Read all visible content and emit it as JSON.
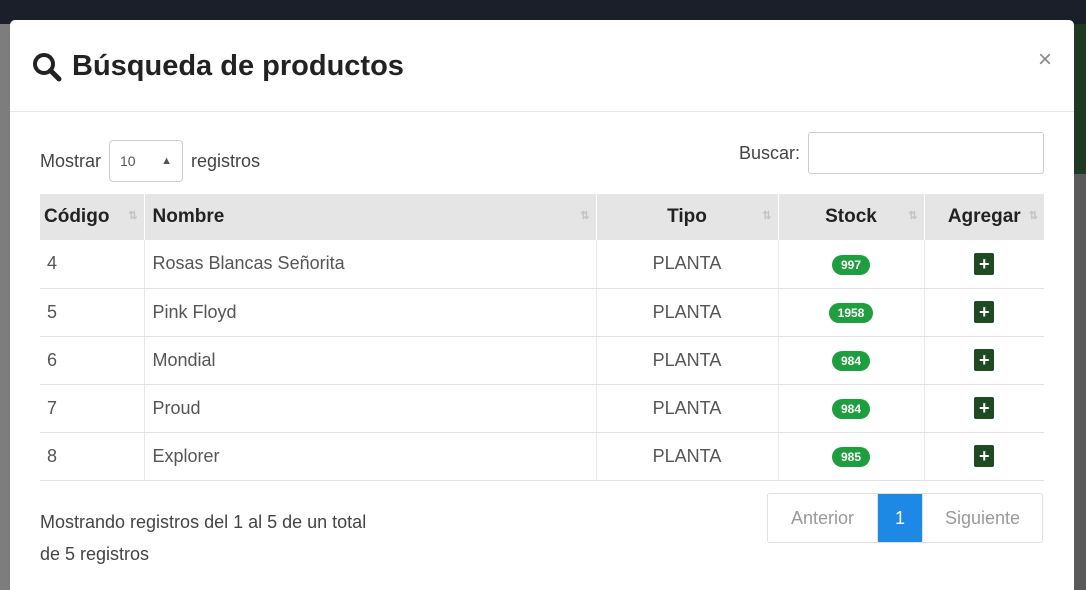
{
  "modal": {
    "title": "Búsqueda de productos",
    "close_label": "×"
  },
  "controls": {
    "show_label": "Mostrar",
    "page_length": "10",
    "records_label": "registros",
    "search_label": "Buscar:",
    "search_value": ""
  },
  "table": {
    "headers": {
      "code": "Código",
      "name": "Nombre",
      "type": "Tipo",
      "stock": "Stock",
      "add": "Agregar"
    },
    "rows": [
      {
        "code": "4",
        "name": "Rosas Blancas Señorita",
        "type": "PLANTA",
        "stock": "997"
      },
      {
        "code": "5",
        "name": "Pink Floyd",
        "type": "PLANTA",
        "stock": "1958"
      },
      {
        "code": "6",
        "name": "Mondial",
        "type": "PLANTA",
        "stock": "984"
      },
      {
        "code": "7",
        "name": "Proud",
        "type": "PLANTA",
        "stock": "984"
      },
      {
        "code": "8",
        "name": "Explorer",
        "type": "PLANTA",
        "stock": "985"
      }
    ],
    "add_symbol": "+"
  },
  "footer": {
    "info_line1": "Mostrando registros del 1 al 5 de un total",
    "info_line2": "de 5 registros",
    "prev_label": "Anterior",
    "current_page": "1",
    "next_label": "Siguiente"
  },
  "colors": {
    "stock_badge": "#1e9e3e",
    "add_button": "#1d4a20",
    "active_page": "#1e88e5"
  }
}
